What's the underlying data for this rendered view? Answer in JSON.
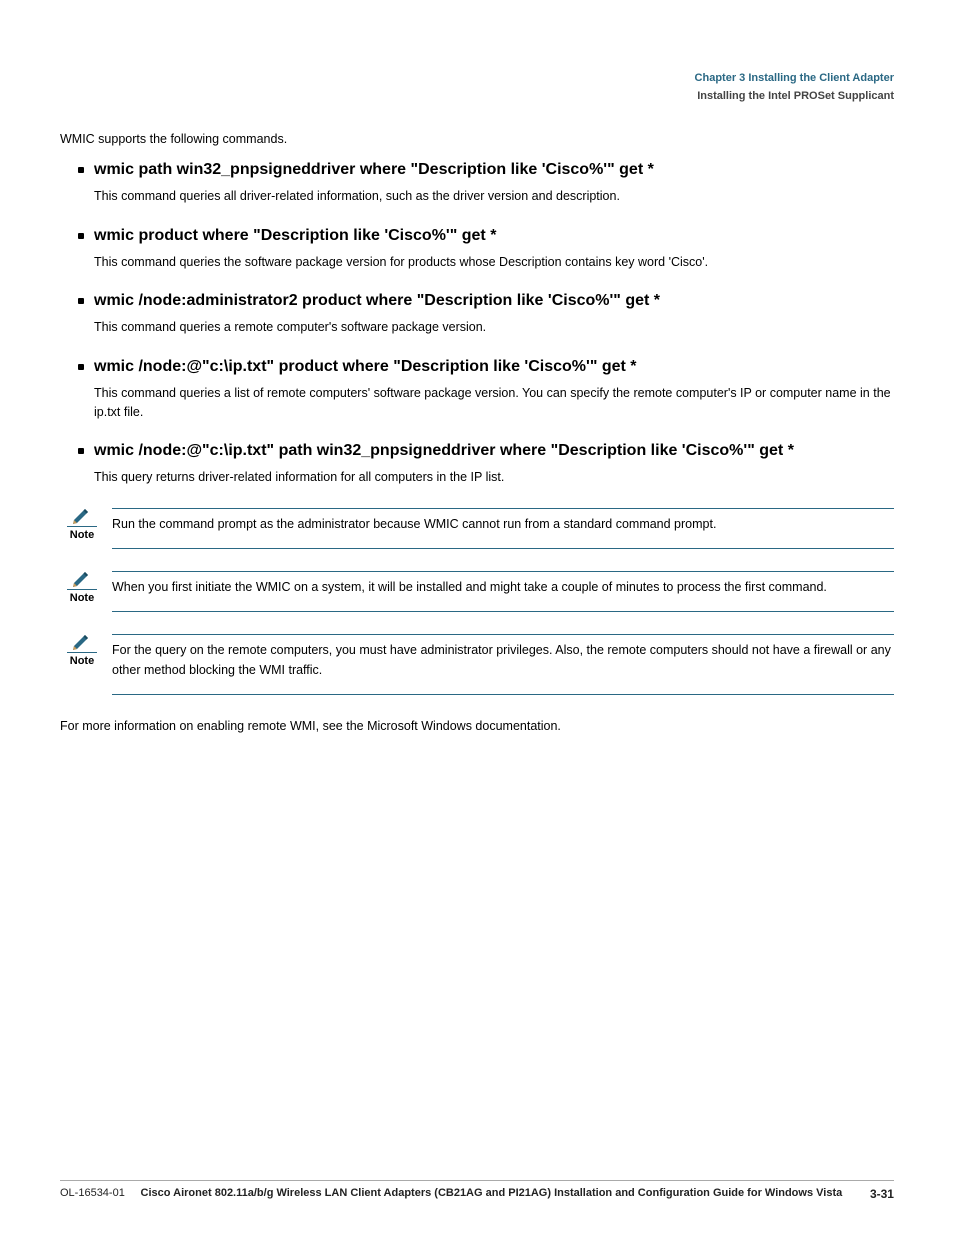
{
  "header": {
    "chapter": "Chapter 3      Installing the Client Adapter",
    "section": "Installing the Intel PROSet Supplicant"
  },
  "list": {
    "lead": "WMIC supports the following commands.",
    "items": [
      {
        "cmd": "wmic path win32_pnpsigneddriver where \"Description like 'Cisco%'\" get *",
        "desc": "This command queries all driver-related information, such as the driver version and description."
      },
      {
        "cmd": "wmic product where \"Description like 'Cisco%'\" get *",
        "desc": "This command queries the software package version for products whose Description contains key word 'Cisco'."
      },
      {
        "cmd": "wmic /node:administrator2 product where \"Description like 'Cisco%'\" get *",
        "desc": "This command queries a remote computer's software package version."
      },
      {
        "cmd": "wmic /node:@\"c:\\ip.txt\" product where \"Description like 'Cisco%'\" get *",
        "desc": "This command queries a list of remote computers' software package version. You can specify the remote computer's IP or computer name in the ip.txt file."
      },
      {
        "cmd": "wmic /node:@\"c:\\ip.txt\" path win32_pnpsigneddriver where \"Description like 'Cisco%'\" get *",
        "desc": "This query returns driver-related information for all computers in the IP list."
      }
    ]
  },
  "notes": [
    {
      "label": "Note",
      "text": "Run the command prompt as the administrator because WMIC cannot run from a standard command prompt."
    },
    {
      "label": "Note",
      "text": "When you first initiate the WMIC on a system, it will be installed and might take a couple of minutes to process the first command."
    },
    {
      "label": "Note",
      "text": "For the query on the remote computers, you must have administrator privileges. Also, the remote computers should not have a firewall or any other method blocking the WMI traffic."
    }
  ],
  "post_notes_para": "For more information on enabling remote WMI, see the Microsoft Windows documentation.",
  "footer": {
    "doc_title": "Cisco Aironet 802.11a/b/g Wireless LAN Client Adapters (CB21AG and PI21AG) Installation and Configuration Guide for Windows Vista",
    "ol": "OL-16534-01",
    "page": "3-31"
  }
}
